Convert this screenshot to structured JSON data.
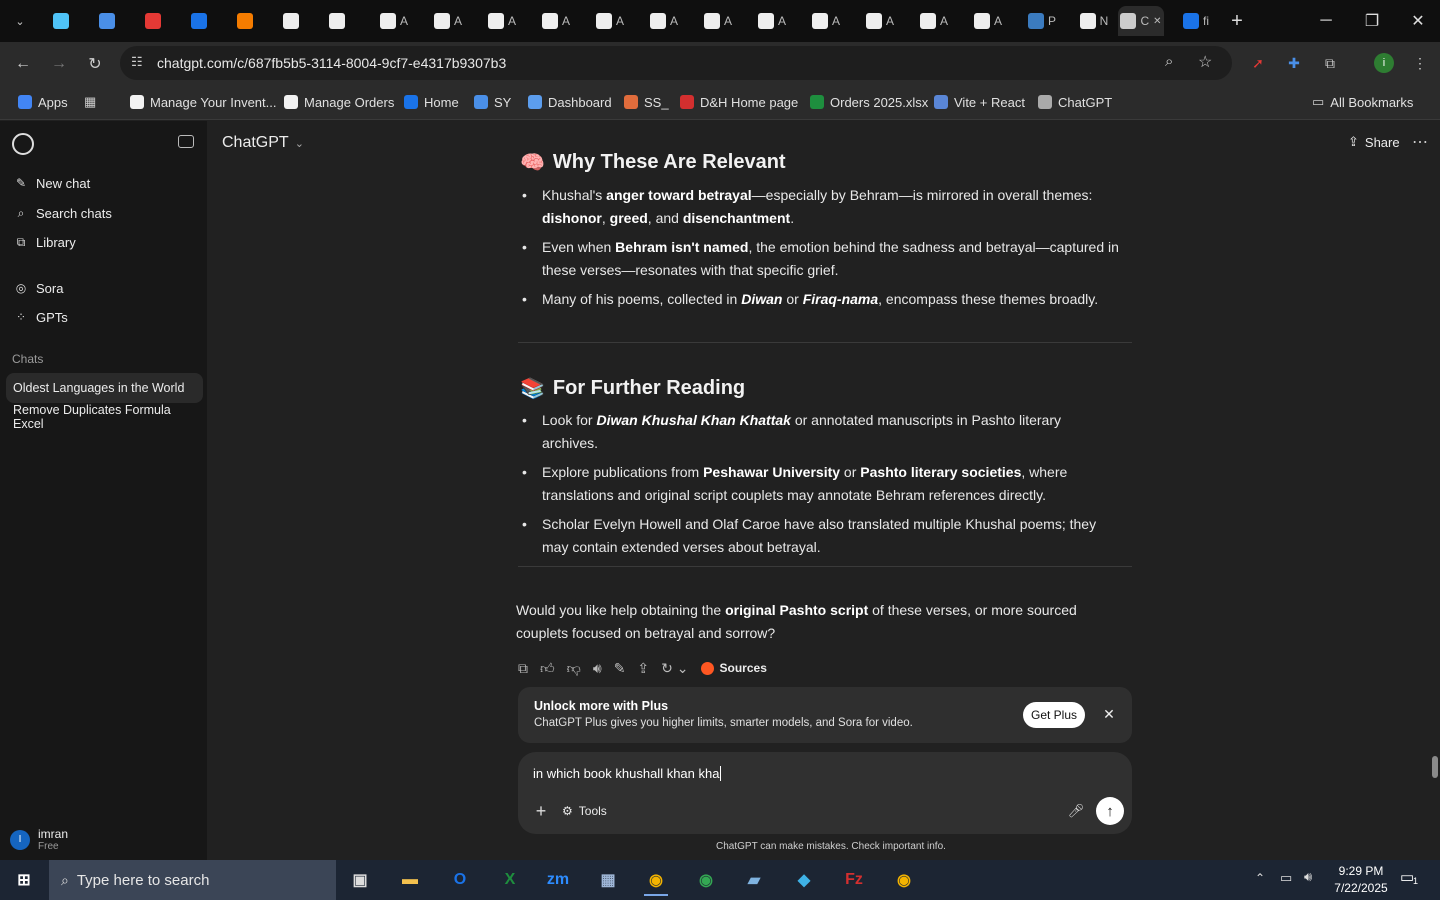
{
  "browser": {
    "tabs": [
      {
        "label": "",
        "icon": "edge-icon"
      },
      {
        "label": "",
        "icon": "ec-icon"
      },
      {
        "label": "",
        "icon": "pdf-icon"
      },
      {
        "label": "",
        "icon": "google-icon"
      },
      {
        "label": "",
        "icon": "box-icon"
      },
      {
        "label": "",
        "icon": "amazon-icon"
      },
      {
        "label": "",
        "icon": "amazon-icon"
      },
      {
        "label": "A",
        "icon": "amazon-icon"
      },
      {
        "label": "A",
        "icon": "amazon-icon"
      },
      {
        "label": "A",
        "icon": "amazon-icon"
      },
      {
        "label": "A",
        "icon": "amazon-icon"
      },
      {
        "label": "A",
        "icon": "amazon-icon"
      },
      {
        "label": "A",
        "icon": "amazon-icon"
      },
      {
        "label": "A",
        "icon": "amazon-icon"
      },
      {
        "label": "A",
        "icon": "amazon-icon"
      },
      {
        "label": "A",
        "icon": "amazon-icon"
      },
      {
        "label": "A",
        "icon": "amazon-icon"
      },
      {
        "label": "A",
        "icon": "amazon-icon"
      },
      {
        "label": "A",
        "icon": "amazon-icon"
      },
      {
        "label": "P",
        "icon": "paypal-icon"
      },
      {
        "label": "N",
        "icon": "amazon-icon"
      },
      {
        "label": "C",
        "icon": "chatgpt-icon",
        "active": true
      },
      {
        "label": "fi",
        "icon": "google-icon"
      }
    ],
    "url": "chatgpt.com/c/687fb5b5-3114-8004-9cf7-e4317b9307b3",
    "bookmarks": [
      {
        "label": "Apps"
      },
      {
        "label": "Manage Your Invent..."
      },
      {
        "label": "Manage Orders"
      },
      {
        "label": "Home"
      },
      {
        "label": "SY"
      },
      {
        "label": "Dashboard"
      },
      {
        "label": "SS_"
      },
      {
        "label": "D&H Home page"
      },
      {
        "label": "Orders 2025.xlsx"
      },
      {
        "label": "Vite + React"
      },
      {
        "label": "ChatGPT"
      }
    ],
    "all_bookmarks": "All Bookmarks"
  },
  "sidebar": {
    "nav": [
      {
        "label": "New chat",
        "icon": "edit-icon"
      },
      {
        "label": "Search chats",
        "icon": "search-icon"
      },
      {
        "label": "Library",
        "icon": "library-icon"
      },
      {
        "label": "Sora",
        "icon": "sora-icon"
      },
      {
        "label": "GPTs",
        "icon": "grid-icon"
      }
    ],
    "chats_heading": "Chats",
    "chats": [
      {
        "label": "Oldest Languages in the World",
        "selected": true
      },
      {
        "label": "Remove Duplicates Formula Excel"
      }
    ],
    "user": {
      "initial": "I",
      "name": "imran",
      "plan": "Free"
    }
  },
  "header": {
    "model": "ChatGPT",
    "share": "Share"
  },
  "message": {
    "section1": {
      "emoji": "🧠",
      "title": "Why These Are Relevant",
      "bullets": [
        [
          "Khushal's ",
          "<b>anger toward betrayal</b>",
          "—especially by Behram—is mirrored in overall themes: ",
          "<b>dishonor</b>",
          ", ",
          "<b>greed</b>",
          ", and ",
          "<b>disenchantment</b>",
          "."
        ],
        [
          "Even when ",
          "<b>Behram isn't named</b>",
          ", the emotion behind the sadness and betrayal—captured in these verses—resonates with that specific grief."
        ],
        [
          "Many of his poems, collected in ",
          "<b><i>Diwan</i></b>",
          " or ",
          "<b><i>Firaq-nama</i></b>",
          ", encompass these themes broadly."
        ]
      ]
    },
    "section2": {
      "emoji": "📚",
      "title": "For Further Reading",
      "bullets": [
        [
          "Look for ",
          "<b><i>Diwan Khushal Khan Khattak</i></b>",
          " or annotated manuscripts in Pashto literary archives."
        ],
        [
          "Explore publications from ",
          "<b>Peshawar University</b>",
          " or ",
          "<b>Pashto literary societies</b>",
          ", where translations and original script couplets may annotate Behram references directly."
        ],
        [
          "Scholar Evelyn Howell and Olaf Caroe have also translated multiple Khushal poems; they may contain extended verses about betrayal."
        ]
      ]
    },
    "closing": [
      "Would you like help obtaining the ",
      "<b>original Pashto script</b>",
      " of these verses, or more sourced couplets focused on betrayal and sorrow?"
    ],
    "sources_label": "Sources"
  },
  "upsell": {
    "title": "Unlock more with Plus",
    "body": "ChatGPT Plus gives you higher limits, smarter models, and Sora for video.",
    "button": "Get Plus"
  },
  "composer": {
    "value": "in which book khushall khan kha",
    "tools": "Tools"
  },
  "disclaimer": "ChatGPT can make mistakes. Check important info.",
  "taskbar": {
    "search_placeholder": "Type here to search",
    "time": "9:29 PM",
    "date": "7/22/2025",
    "notifications": "1"
  }
}
